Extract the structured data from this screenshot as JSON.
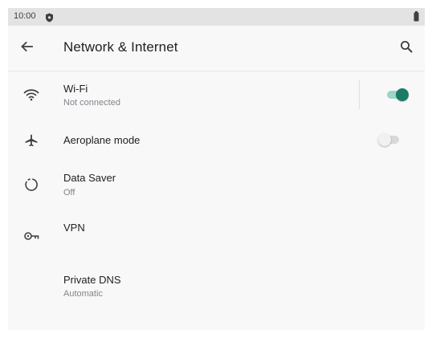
{
  "status_bar": {
    "time": "10:00",
    "icons": [
      "shield-icon",
      "battery-icon"
    ]
  },
  "toolbar": {
    "title": "Network & Internet",
    "back_icon": "arrow-left-icon",
    "search_icon": "search-icon"
  },
  "settings": [
    {
      "id": "wifi",
      "icon": "wifi-icon",
      "title": "Wi-Fi",
      "subtitle": "Not connected",
      "toggle": true
    },
    {
      "id": "aeroplane",
      "icon": "airplane-icon",
      "title": "Aeroplane mode",
      "subtitle": "",
      "toggle": false
    },
    {
      "id": "data-saver",
      "icon": "data-saver-icon",
      "title": "Data Saver",
      "subtitle": "Off"
    },
    {
      "id": "vpn",
      "icon": "vpn-key-icon",
      "title": "VPN",
      "subtitle": ""
    },
    {
      "id": "private-dns",
      "icon": "",
      "title": "Private DNS",
      "subtitle": "Automatic"
    }
  ],
  "colors": {
    "accent": "#1a7b67",
    "accent_track": "#9fd4c8",
    "status_bar": "#e3e3e3",
    "background": "#f8f8f8",
    "secondary_text": "#80868b"
  }
}
